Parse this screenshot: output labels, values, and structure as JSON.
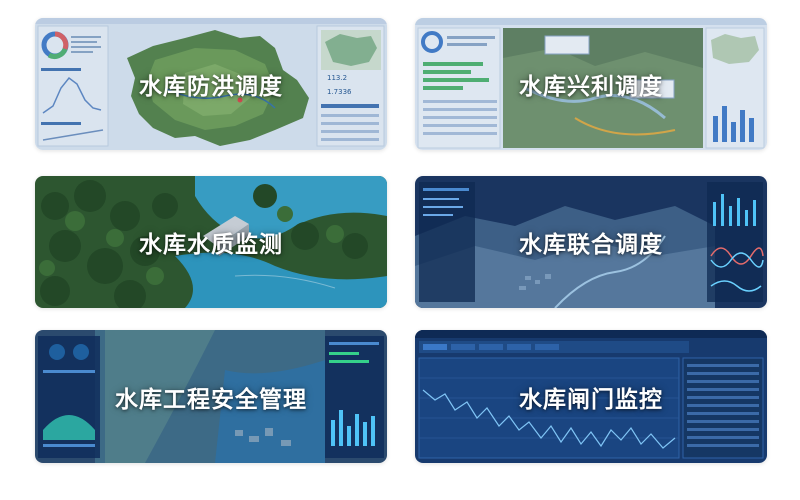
{
  "modules": [
    {
      "id": "flood",
      "title": "水库防洪调度",
      "thumbnail_icon": "flood-dispatch-dashboard-thumbnail"
    },
    {
      "id": "benefit",
      "title": "水库兴利调度",
      "thumbnail_icon": "benefit-dispatch-dashboard-thumbnail"
    },
    {
      "id": "water-quality",
      "title": "水库水质监测",
      "thumbnail_icon": "water-quality-3d-scene-thumbnail"
    },
    {
      "id": "joint",
      "title": "水库联合调度",
      "thumbnail_icon": "joint-dispatch-3d-terrain-thumbnail"
    },
    {
      "id": "safety",
      "title": "水库工程安全管理",
      "thumbnail_icon": "engineering-safety-dashboard-thumbnail"
    },
    {
      "id": "gate",
      "title": "水库闸门监控",
      "thumbnail_icon": "gate-monitoring-chart-thumbnail"
    }
  ],
  "thumbnail_readouts": {
    "flood_level": "113.2",
    "flood_flow": "1.7336"
  },
  "colors": {
    "label_text": "#ffffff",
    "dashboard_light": "#e3edf7",
    "dashboard_dark": "#0f2d5c",
    "water": "#2f9fc8",
    "forest": "#2f5a2c"
  }
}
